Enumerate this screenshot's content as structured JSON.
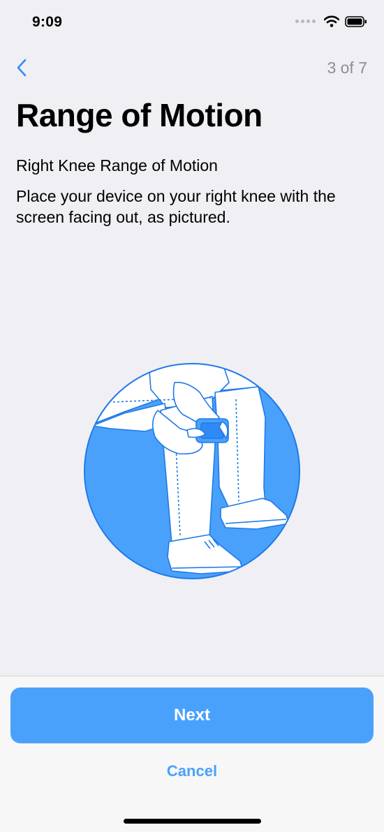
{
  "status_bar": {
    "time": "9:09",
    "icons": [
      "signal-dots-icon",
      "wifi-icon",
      "battery-icon"
    ]
  },
  "nav": {
    "back_icon": "chevron-left-icon",
    "step_counter": "3 of 7"
  },
  "content": {
    "title": "Range of Motion",
    "subtitle": "Right Knee Range of Motion",
    "instruction": "Place your device on your right knee with the screen facing out, as pictured.",
    "illustration": "person-holding-phone-on-knee-illustration"
  },
  "actions": {
    "next_label": "Next",
    "cancel_label": "Cancel"
  },
  "colors": {
    "accent": "#4aa1fb",
    "background": "#efeff4",
    "secondary_text": "#8e8e93"
  }
}
